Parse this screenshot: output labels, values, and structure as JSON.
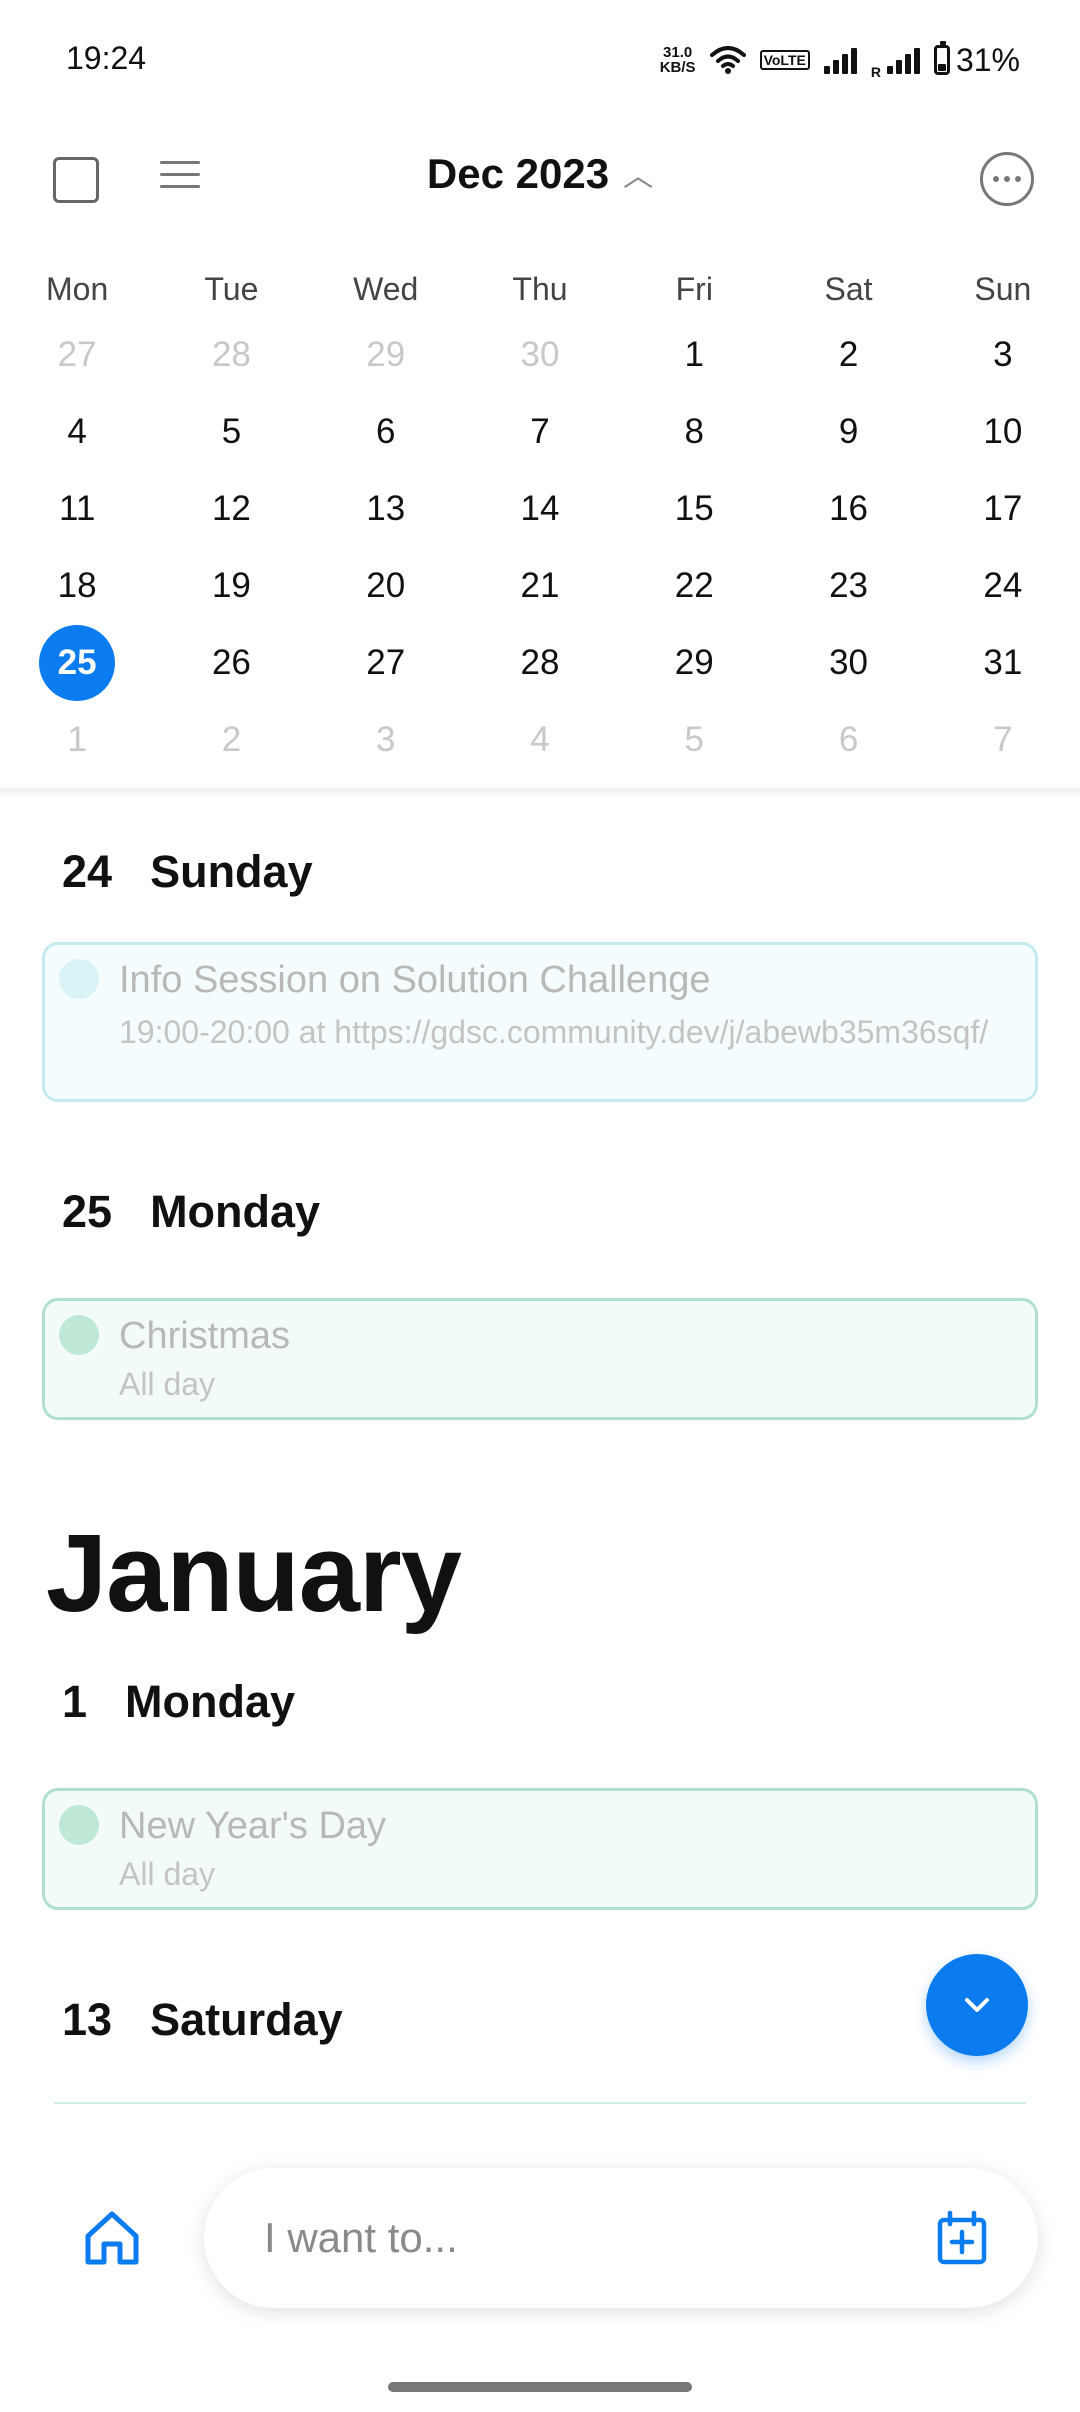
{
  "status_bar": {
    "time": "19:24",
    "net_speed_value": "31.0",
    "net_speed_unit": "KB/S",
    "volte_label": "VoLTE",
    "roaming_label": "R",
    "battery_percent": "31%",
    "battery_level": 0.31
  },
  "header": {
    "month_title": "Dec 2023",
    "checkbox_icon": "checkbox-icon",
    "list_icon": "list-icon",
    "more_icon": "more-options-icon"
  },
  "calendar": {
    "weekdays": [
      "Mon",
      "Tue",
      "Wed",
      "Thu",
      "Fri",
      "Sat",
      "Sun"
    ],
    "weeks": [
      [
        "27",
        "28",
        "29",
        "30",
        "1",
        "2",
        "3"
      ],
      [
        "4",
        "5",
        "6",
        "7",
        "8",
        "9",
        "10"
      ],
      [
        "11",
        "12",
        "13",
        "14",
        "15",
        "16",
        "17"
      ],
      [
        "18",
        "19",
        "20",
        "21",
        "22",
        "23",
        "24"
      ],
      [
        "25",
        "26",
        "27",
        "28",
        "29",
        "30",
        "31"
      ],
      [
        "1",
        "2",
        "3",
        "4",
        "5",
        "6",
        "7"
      ]
    ],
    "today": "25",
    "accent_color": "#0a7cf0"
  },
  "agenda": {
    "sections": [
      {
        "day_number": "24",
        "day_name": "Sunday",
        "event": {
          "title": "Info Session on Solution Challenge",
          "subtitle": "19:00-20:00 at https://gdsc.community.dev/j/abewb35m36sqf/",
          "color": "teal"
        }
      },
      {
        "day_number": "25",
        "day_name": "Monday",
        "event": {
          "title": "Christmas",
          "subtitle": "All day",
          "color": "green"
        }
      }
    ],
    "month_heading": "January",
    "jan_sections": [
      {
        "day_number": "1",
        "day_name": "Monday",
        "event": {
          "title": "New Year's Day",
          "subtitle": "All day",
          "color": "green"
        }
      },
      {
        "day_number": "13",
        "day_name": "Saturday"
      }
    ]
  },
  "fab": {
    "icon": "chevron-down-icon"
  },
  "bottom_bar": {
    "home_icon": "home-icon",
    "input_placeholder": "I want to...",
    "add_event_icon": "calendar-add-icon"
  }
}
